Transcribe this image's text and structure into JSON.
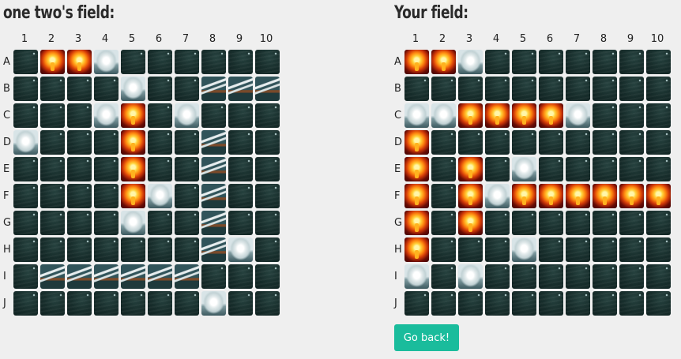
{
  "opponent_board": {
    "title": "one two's field:",
    "columns": [
      "1",
      "2",
      "3",
      "4",
      "5",
      "6",
      "7",
      "8",
      "9",
      "10"
    ],
    "rows": [
      "A",
      "B",
      "C",
      "D",
      "E",
      "F",
      "G",
      "H",
      "I",
      "J"
    ],
    "cells": [
      [
        "water",
        "hit",
        "hit",
        "miss",
        "water",
        "water",
        "water",
        "water",
        "water",
        "water"
      ],
      [
        "water",
        "water",
        "water",
        "water",
        "miss",
        "water",
        "water",
        "ship",
        "ship",
        "ship"
      ],
      [
        "water",
        "water",
        "water",
        "miss",
        "hit",
        "water",
        "miss",
        "water",
        "water",
        "water"
      ],
      [
        "miss",
        "water",
        "water",
        "water",
        "hit",
        "water",
        "water",
        "ship",
        "water",
        "water"
      ],
      [
        "water",
        "water",
        "water",
        "water",
        "hit",
        "water",
        "water",
        "ship",
        "water",
        "water"
      ],
      [
        "water",
        "water",
        "water",
        "water",
        "hit",
        "miss",
        "water",
        "ship",
        "water",
        "water"
      ],
      [
        "water",
        "water",
        "water",
        "water",
        "miss",
        "water",
        "water",
        "ship",
        "water",
        "water"
      ],
      [
        "water",
        "water",
        "water",
        "water",
        "water",
        "water",
        "water",
        "ship",
        "miss",
        "water"
      ],
      [
        "water",
        "ship",
        "ship",
        "ship",
        "ship",
        "ship",
        "ship",
        "water",
        "water",
        "water"
      ],
      [
        "water",
        "water",
        "water",
        "water",
        "water",
        "water",
        "water",
        "miss",
        "water",
        "water"
      ]
    ]
  },
  "own_board": {
    "title": "Your field:",
    "columns": [
      "1",
      "2",
      "3",
      "4",
      "5",
      "6",
      "7",
      "8",
      "9",
      "10"
    ],
    "rows": [
      "A",
      "B",
      "C",
      "D",
      "E",
      "F",
      "G",
      "H",
      "I",
      "J"
    ],
    "cells": [
      [
        "hit",
        "hit",
        "miss",
        "water",
        "water",
        "water",
        "water",
        "water",
        "water",
        "water"
      ],
      [
        "water",
        "water",
        "water",
        "water",
        "water",
        "water",
        "water",
        "water",
        "water",
        "water"
      ],
      [
        "miss",
        "miss",
        "hit",
        "hit",
        "hit",
        "hit",
        "miss",
        "water",
        "water",
        "water"
      ],
      [
        "hit",
        "water",
        "water",
        "water",
        "water",
        "water",
        "water",
        "water",
        "water",
        "water"
      ],
      [
        "hit",
        "water",
        "hit",
        "water",
        "miss",
        "water",
        "water",
        "water",
        "water",
        "water"
      ],
      [
        "hit",
        "water",
        "hit",
        "miss",
        "hit",
        "hit",
        "hit",
        "hit",
        "hit",
        "hit"
      ],
      [
        "hit",
        "water",
        "hit",
        "water",
        "water",
        "water",
        "water",
        "water",
        "water",
        "water"
      ],
      [
        "hit",
        "water",
        "water",
        "water",
        "miss",
        "water",
        "water",
        "water",
        "water",
        "water"
      ],
      [
        "miss",
        "water",
        "miss",
        "water",
        "water",
        "water",
        "water",
        "water",
        "water",
        "water"
      ],
      [
        "water",
        "water",
        "water",
        "water",
        "water",
        "water",
        "water",
        "water",
        "water",
        "water"
      ]
    ]
  },
  "actions": {
    "go_back_label": "Go back!"
  },
  "colors": {
    "background": "#efefef",
    "button": "#1abc9c",
    "button_text": "#ffffff"
  },
  "legend_icons": {
    "water": "sea-tile-icon",
    "miss": "splash-tile-icon",
    "hit": "explosion-tile-icon",
    "ship": "ship-tile-icon"
  }
}
